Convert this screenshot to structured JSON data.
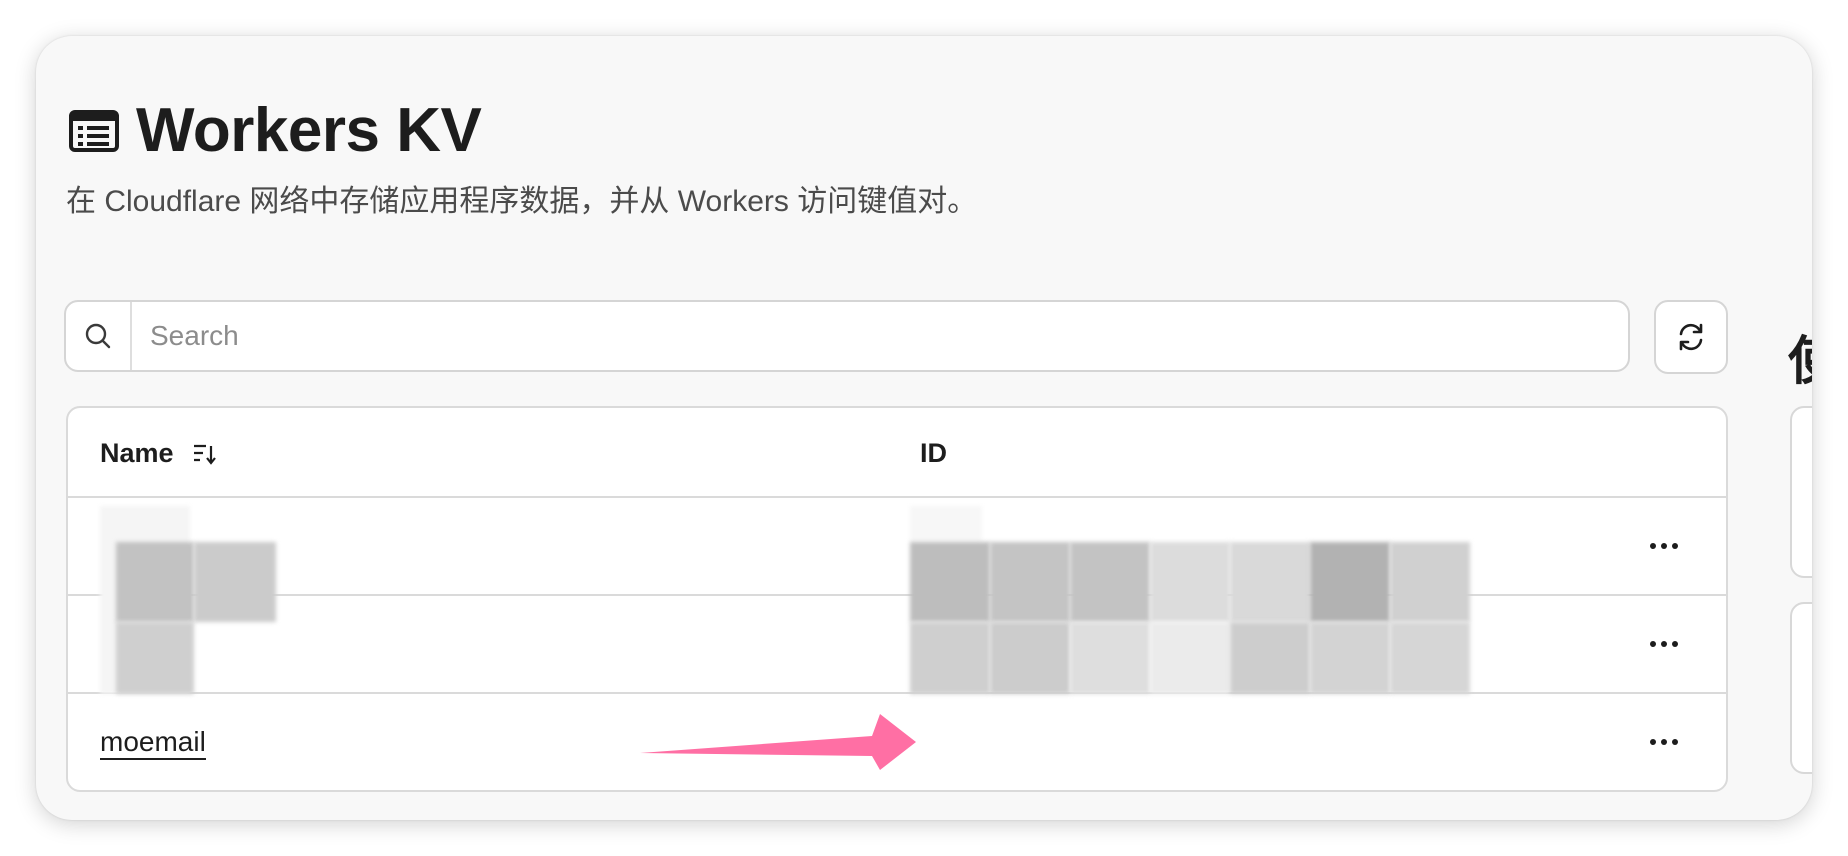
{
  "page": {
    "title": "Workers KV",
    "subtitle": "在 Cloudflare 网络中存储应用程序数据，并从 Workers 访问键值对。",
    "side_title_fragment": "使"
  },
  "search": {
    "placeholder": "Search",
    "value": ""
  },
  "icons": {
    "title": "list-document-icon",
    "search": "search-icon",
    "refresh": "refresh-icon",
    "sort": "sort-icon",
    "row_menu": "more-horizontal-icon"
  },
  "table": {
    "columns": [
      {
        "label": "Name"
      },
      {
        "label": "ID"
      }
    ],
    "rows": [
      {
        "name": "",
        "id": "",
        "redacted": true
      },
      {
        "name": "",
        "id": "",
        "redacted": true
      },
      {
        "name": "moemail",
        "id": "",
        "redacted": false
      }
    ],
    "row_menu_label": "···"
  },
  "colors": {
    "background": "#f8f8f8",
    "panel": "#ffffff",
    "border": "#dadada",
    "text": "#1d1d1d",
    "muted": "#4b4b4b",
    "annotation_arrow": "#ff6fa4"
  }
}
